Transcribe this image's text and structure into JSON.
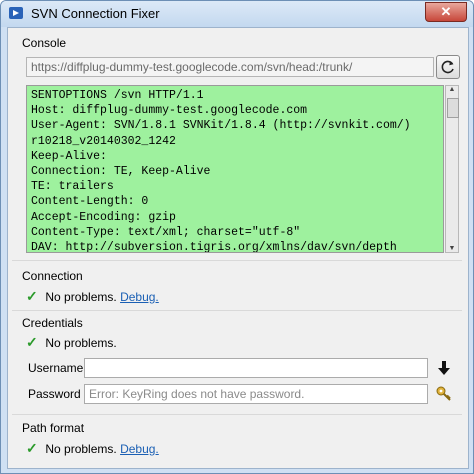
{
  "window": {
    "title": "SVN Connection Fixer",
    "close_glyph": "✕"
  },
  "console_group": {
    "title": "Console",
    "url": "https://diffplug-dummy-test.googlecode.com/svn/head:/trunk/",
    "lines": [
      "SENTOPTIONS /svn HTTP/1.1",
      "Host: diffplug-dummy-test.googlecode.com",
      "User-Agent: SVN/1.8.1 SVNKit/1.8.4 (http://svnkit.com/)",
      "r10218_v20140302_1242",
      "Keep-Alive:",
      "Connection: TE, Keep-Alive",
      "TE: trailers",
      "Content-Length: 0",
      "Accept-Encoding: gzip",
      "Content-Type: text/xml; charset=\"utf-8\"",
      "DAV: http://subversion.tigris.org/xmlns/dav/svn/depth"
    ]
  },
  "connection_group": {
    "title": "Connection",
    "status": "No problems.",
    "link": "Debug."
  },
  "credentials_group": {
    "title": "Credentials",
    "status": "No problems.",
    "username_label": "Username",
    "username_value": "",
    "password_label": "Password",
    "password_placeholder": "Error: KeyRing does not have password."
  },
  "path_group": {
    "title": "Path format",
    "status": "No problems.",
    "link": "Debug."
  },
  "icons": [
    "app-icon",
    "close-icon",
    "refresh-icon",
    "check-icon",
    "download-arrow-icon",
    "key-icon"
  ]
}
